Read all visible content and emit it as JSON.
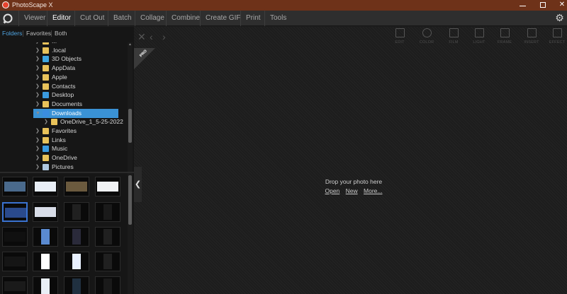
{
  "window": {
    "title": "PhotoScape X"
  },
  "menu": {
    "items": [
      "Viewer",
      "Editor",
      "Cut Out",
      "Batch",
      "Collage",
      "Combine",
      "Create GIF",
      "Print",
      "Tools"
    ],
    "active": "Editor"
  },
  "sidebar": {
    "tabs": [
      "Folders",
      "Favorites",
      "Both"
    ],
    "active_tab": "Folders",
    "tree": [
      {
        "label": "...",
        "icon": "folder-icon",
        "color": "#e8c25a",
        "indent": 0
      },
      {
        "label": ".local",
        "icon": "folder-icon",
        "color": "#e8c25a",
        "indent": 0
      },
      {
        "label": "3D Objects",
        "icon": "cube-folder-icon",
        "color": "#3fa6e0",
        "indent": 0
      },
      {
        "label": "AppData",
        "icon": "folder-icon",
        "color": "#e8c25a",
        "indent": 0
      },
      {
        "label": "Apple",
        "icon": "folder-icon",
        "color": "#e8c25a",
        "indent": 0
      },
      {
        "label": "Contacts",
        "icon": "contacts-folder-icon",
        "color": "#e8c25a",
        "indent": 0
      },
      {
        "label": "Desktop",
        "icon": "desktop-folder-icon",
        "color": "#3a9be0",
        "indent": 0
      },
      {
        "label": "Documents",
        "icon": "documents-folder-icon",
        "color": "#e8c25a",
        "indent": 0
      },
      {
        "label": "Downloads",
        "icon": "download-folder-icon",
        "color": "#3a8ee0",
        "indent": 0,
        "selected": true,
        "expanded": true
      },
      {
        "label": "OneDrive_1_5-25-2022",
        "icon": "folder-icon",
        "color": "#e8c25a",
        "indent": 1
      },
      {
        "label": "Favorites",
        "icon": "favorites-folder-icon",
        "color": "#e8c25a",
        "indent": 0
      },
      {
        "label": "Links",
        "icon": "links-folder-icon",
        "color": "#e8c25a",
        "indent": 0
      },
      {
        "label": "Music",
        "icon": "music-folder-icon",
        "color": "#3a9be0",
        "indent": 0
      },
      {
        "label": "OneDrive",
        "icon": "folder-icon",
        "color": "#e8c25a",
        "indent": 0
      },
      {
        "label": "Pictures",
        "icon": "pictures-folder-icon",
        "color": "#b0c8e0",
        "indent": 0
      }
    ]
  },
  "toolbar": {
    "tools": [
      {
        "label": "EDIT",
        "icon": "edit-icon"
      },
      {
        "label": "COLOR",
        "icon": "color-icon"
      },
      {
        "label": "FILM",
        "icon": "film-icon"
      },
      {
        "label": "LIGHT",
        "icon": "light-icon"
      },
      {
        "label": "FRAME",
        "icon": "frame-icon"
      },
      {
        "label": "INSERT",
        "icon": "insert-icon"
      },
      {
        "label": "EFFECT",
        "icon": "effect-icon"
      }
    ]
  },
  "badge": {
    "label": "PRO"
  },
  "drop": {
    "message": "Drop your photo here",
    "links": [
      "Open",
      "New",
      "More..."
    ]
  }
}
